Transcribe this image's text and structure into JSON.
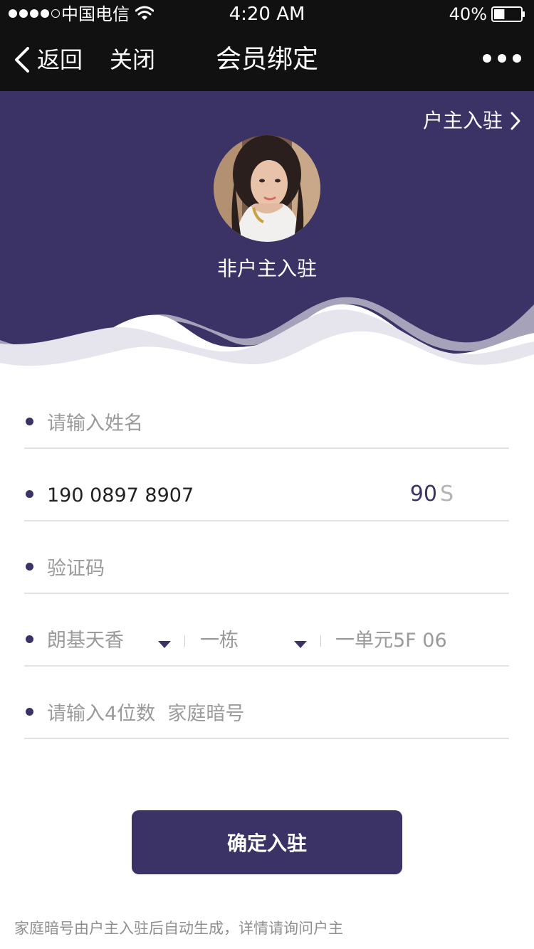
{
  "status_bar": {
    "carrier": "中国电信",
    "time": "4:20 AM",
    "battery": "40%",
    "battery_level": 0.4
  },
  "nav": {
    "back_label": "返回",
    "close_label": "关闭",
    "title": "会员绑定"
  },
  "hero": {
    "owner_link": "户主入驻",
    "label": "非户主入驻"
  },
  "form": {
    "name_placeholder": "请输入姓名",
    "phone": "190 0897 8907",
    "countdown_value": "90",
    "countdown_unit": "S",
    "code_placeholder": "验证码",
    "address": {
      "community": "朗基天香",
      "building": "一栋",
      "unit": "一单元5F 06"
    },
    "secret_placeholder": "请输入4位数  家庭暗号"
  },
  "submit_label": "确定入驻",
  "footer_note": "家庭暗号由户主入驻后自动生成，详情请询问户主",
  "colors": {
    "accent": "#3b3266",
    "bar": "#111111"
  }
}
